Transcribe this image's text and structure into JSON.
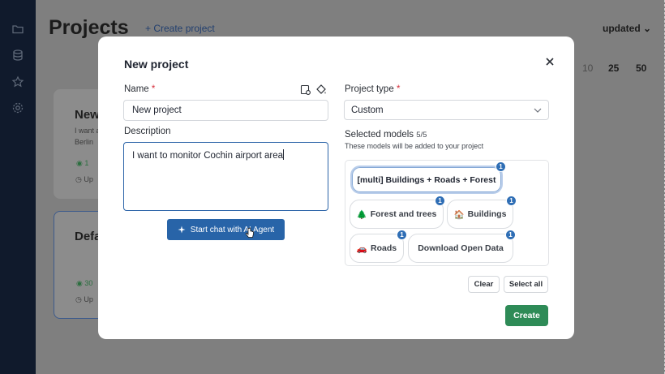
{
  "background": {
    "page_title": "Projects",
    "create_project_label": "+ Create project",
    "sort_label": "updated",
    "page_sizes": [
      "10",
      "25",
      "50"
    ],
    "cards": [
      {
        "title": "New",
        "line1": "I want a",
        "line2": "Berlin",
        "count": "1",
        "meta": "Up"
      },
      {
        "title": "Defa",
        "count": "30",
        "meta": "Up"
      }
    ]
  },
  "modal": {
    "title": "New project",
    "name_label": "Name",
    "required_mark": "*",
    "name_value": "New project",
    "description_label": "Description",
    "description_value": "I want to monitor Cochin airport area",
    "ai_button_label": "Start chat with AI Agent",
    "project_type_label": "Project type",
    "project_type_value": "Custom",
    "selected_models_label": "Selected models",
    "selected_models_count": "5/5",
    "models_hint": "These models will be added to your project",
    "models": [
      {
        "label": "[multi] Buildings + Roads + Forest",
        "icon": "",
        "badge": "1"
      },
      {
        "label": "Forest and trees",
        "icon": "tree-icon",
        "badge": "1"
      },
      {
        "label": "Buildings",
        "icon": "house-icon",
        "badge": "1"
      },
      {
        "label": "Roads",
        "icon": "car-icon",
        "badge": "1"
      },
      {
        "label": "Download Open Data",
        "icon": "",
        "badge": "1"
      }
    ],
    "clear_label": "Clear",
    "select_all_label": "Select all",
    "create_label": "Create"
  },
  "colors": {
    "primary": "#2864a8",
    "success": "#2e8b57",
    "sidebar": "#101a2c",
    "badge": "#2f6eb5"
  }
}
